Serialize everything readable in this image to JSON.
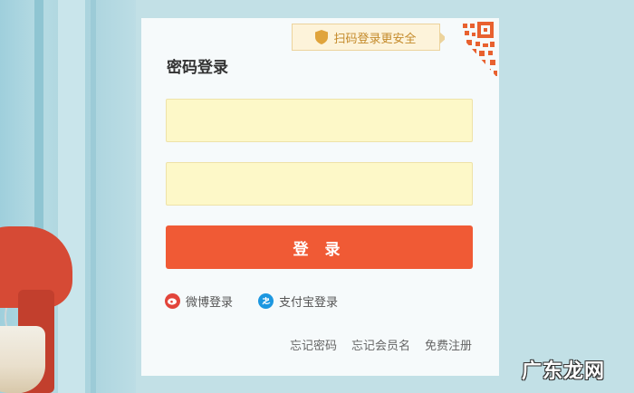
{
  "login": {
    "title": "密码登录",
    "qr_tip": "扫码登录更安全",
    "username_placeholder": "",
    "password_placeholder": "",
    "submit_label": "登 录",
    "alt_logins": [
      {
        "label": "微博登录",
        "icon": "weibo-icon"
      },
      {
        "label": "支付宝登录",
        "icon": "alipay-icon"
      }
    ],
    "links": {
      "forgot_password": "忘记密码",
      "forgot_member_name": "忘记会员名",
      "register": "免费注册"
    }
  },
  "watermark": "广东龙网",
  "colors": {
    "background": "#c2e0e6",
    "panel": "#f6fafb",
    "field_bg": "#fdf8c8",
    "primary": "#f05a35",
    "qr_tip_bg": "#fdf3da",
    "qr_tip_text": "#c48a2a",
    "qr_pattern": "#e8612f"
  }
}
